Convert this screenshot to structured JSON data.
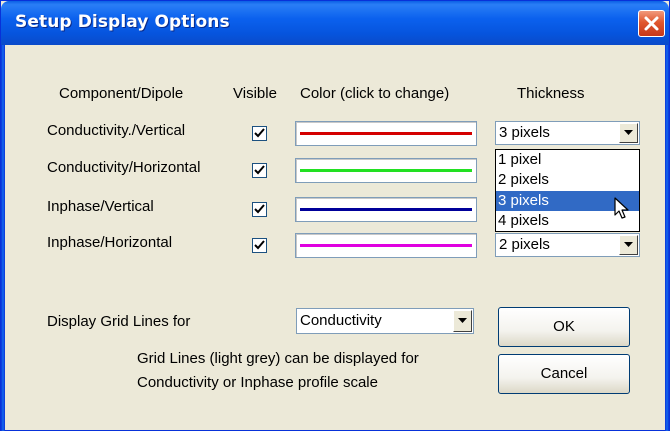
{
  "window": {
    "title": "Setup Display Options"
  },
  "headers": {
    "component": "Component/Dipole",
    "visible": "Visible",
    "color": "Color (click to change)",
    "thickness": "Thickness"
  },
  "rows": [
    {
      "label": "Conductivity./Vertical",
      "visible": true,
      "color": "#d40000",
      "thickness": "3 pixels"
    },
    {
      "label": "Conductivity/Horizontal",
      "visible": true,
      "color": "#22e022",
      "thickness": ""
    },
    {
      "label": "Inphase/Vertical",
      "visible": true,
      "color": "#00009a",
      "thickness": ""
    },
    {
      "label": "Inphase/Horizontal",
      "visible": true,
      "color": "#e000e0",
      "thickness": "2 pixels"
    }
  ],
  "thickness_dropdown": {
    "options": [
      "1 pixel",
      "2 pixels",
      "3 pixels",
      "4 pixels"
    ],
    "highlighted": "3 pixels"
  },
  "grid": {
    "label": "Display Grid Lines for",
    "selected": "Conductivity",
    "note_line1": "Grid Lines (light grey) can be displayed for",
    "note_line2": "Conductivity or Inphase profile scale"
  },
  "buttons": {
    "ok": "OK",
    "cancel": "Cancel"
  },
  "icons": {
    "close": "close-icon",
    "check": "checkmark-icon",
    "dropdown_arrow": "chevron-down-icon",
    "cursor": "mouse-pointer-icon"
  },
  "colors": {
    "titlebar": "#0a5fe4",
    "window_bg": "#ece9d8",
    "selection": "#316ac5"
  }
}
